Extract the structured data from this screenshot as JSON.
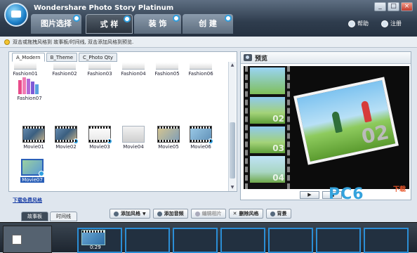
{
  "app": {
    "title": "Wondershare Photo Story Platinum"
  },
  "window_buttons": {
    "minimize": "_",
    "maximize": "□",
    "close": "×"
  },
  "main_tabs": [
    {
      "label": "图片选择"
    },
    {
      "label": "式 样"
    },
    {
      "label": "装 饰"
    },
    {
      "label": "创 建"
    }
  ],
  "top_right": {
    "help": "帮助",
    "register": "注册"
  },
  "hint": "双击或拖拽风格到 故事板/时间线, 双击添加风格到预览.",
  "style_tabs": [
    "A_Modern",
    "B_Theme",
    "C_Photo Qty"
  ],
  "styles_row1": [
    "Fashion01",
    "Fashion02",
    "Fashion03",
    "Fashion04",
    "Fashion05",
    "Fashion06"
  ],
  "styles_row2": [
    "Fashion07"
  ],
  "movies_row1": [
    "Movie01",
    "Movie02",
    "Movie03",
    "Movie04",
    "Movie05",
    "Movie06"
  ],
  "movies_row2": [
    "Movie07"
  ],
  "download_link": "下载免费风格",
  "preview": {
    "title": "预览",
    "frame_numbers": [
      "02",
      "03",
      "04"
    ],
    "big_number": "02",
    "play": "▶",
    "stop": "■"
  },
  "watermark": {
    "brand": "PC6",
    "suffix": "下载"
  },
  "bottom_tabs": [
    "故事板",
    "时间线"
  ],
  "actions": {
    "add_style": "添加风格",
    "add_audio": "添加音频",
    "edit_photo": "编辑相片",
    "delete_style": "删除风格",
    "background": "背景"
  },
  "timeline": {
    "clip_time": "0:29"
  },
  "colors": {
    "accent": "#2e9fe0",
    "selection": "#2a5fb8",
    "titlebar": "#2f3d4e"
  }
}
